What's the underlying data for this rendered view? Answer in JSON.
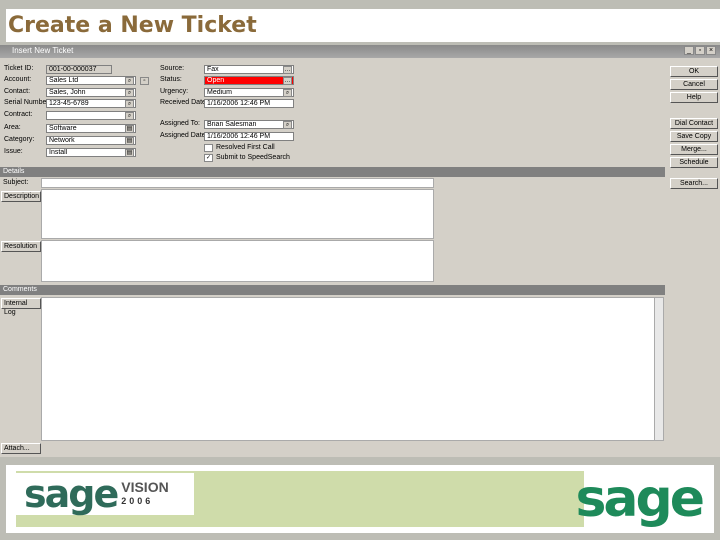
{
  "slide_title": "Create a New Ticket",
  "window": {
    "title": "Insert New Ticket",
    "controls": [
      "_",
      "▫",
      "×"
    ]
  },
  "left_fields": [
    {
      "label": "Ticket ID:",
      "value": "001-00-000037",
      "readonly": true
    },
    {
      "label": "Account:",
      "value": "Sales Ltd",
      "icon": "lookup"
    },
    {
      "label": "Contact:",
      "value": "Sales, John",
      "icon": "lookup"
    },
    {
      "label": "Serial Number:",
      "value": "123-45-6789",
      "icon": "lookup"
    },
    {
      "label": "Contract:",
      "value": "",
      "icon": "lookup"
    },
    {
      "label": "Area:",
      "value": "Software",
      "icon": "list"
    },
    {
      "label": "Category:",
      "value": "Network",
      "icon": "list"
    },
    {
      "label": "Issue:",
      "value": "Install",
      "icon": "list"
    }
  ],
  "right_fields": [
    {
      "label": "Source:",
      "value": "Fax",
      "icon": "ellipsis"
    },
    {
      "label": "Status:",
      "value": "Open",
      "icon": "ellipsis",
      "highlight": "#ff0000"
    },
    {
      "label": "Urgency:",
      "value": "Medium",
      "icon": "lookup"
    },
    {
      "label": "Received Date:",
      "value": "1/16/2006 12:46 PM",
      "icon": ""
    },
    {
      "label": "Assigned To:",
      "value": "Brian Salesman",
      "icon": "lookup"
    },
    {
      "label": "Assigned Date:",
      "value": "1/16/2006 12:46 PM",
      "icon": ""
    }
  ],
  "checkboxes": [
    {
      "label": "Resolved First Call",
      "checked": false
    },
    {
      "label": "Submit to SpeedSearch",
      "checked": true
    }
  ],
  "buttons": [
    "OK",
    "Cancel",
    "Help"
  ],
  "action_buttons": [
    "Dial Contact",
    "Save Copy",
    "Merge...",
    "Schedule",
    "Search..."
  ],
  "details": {
    "header": "Details",
    "subject_label": "Subject:",
    "description_btn": "Description",
    "resolution_btn": "Resolution"
  },
  "comments": {
    "header": "Comments",
    "internal_btn": "Internal Log",
    "attach_btn": "Attach..."
  },
  "footer": {
    "logo_left": "sage VISION 2006",
    "logo_right": "sage",
    "band_color": "#cfdcaa"
  }
}
